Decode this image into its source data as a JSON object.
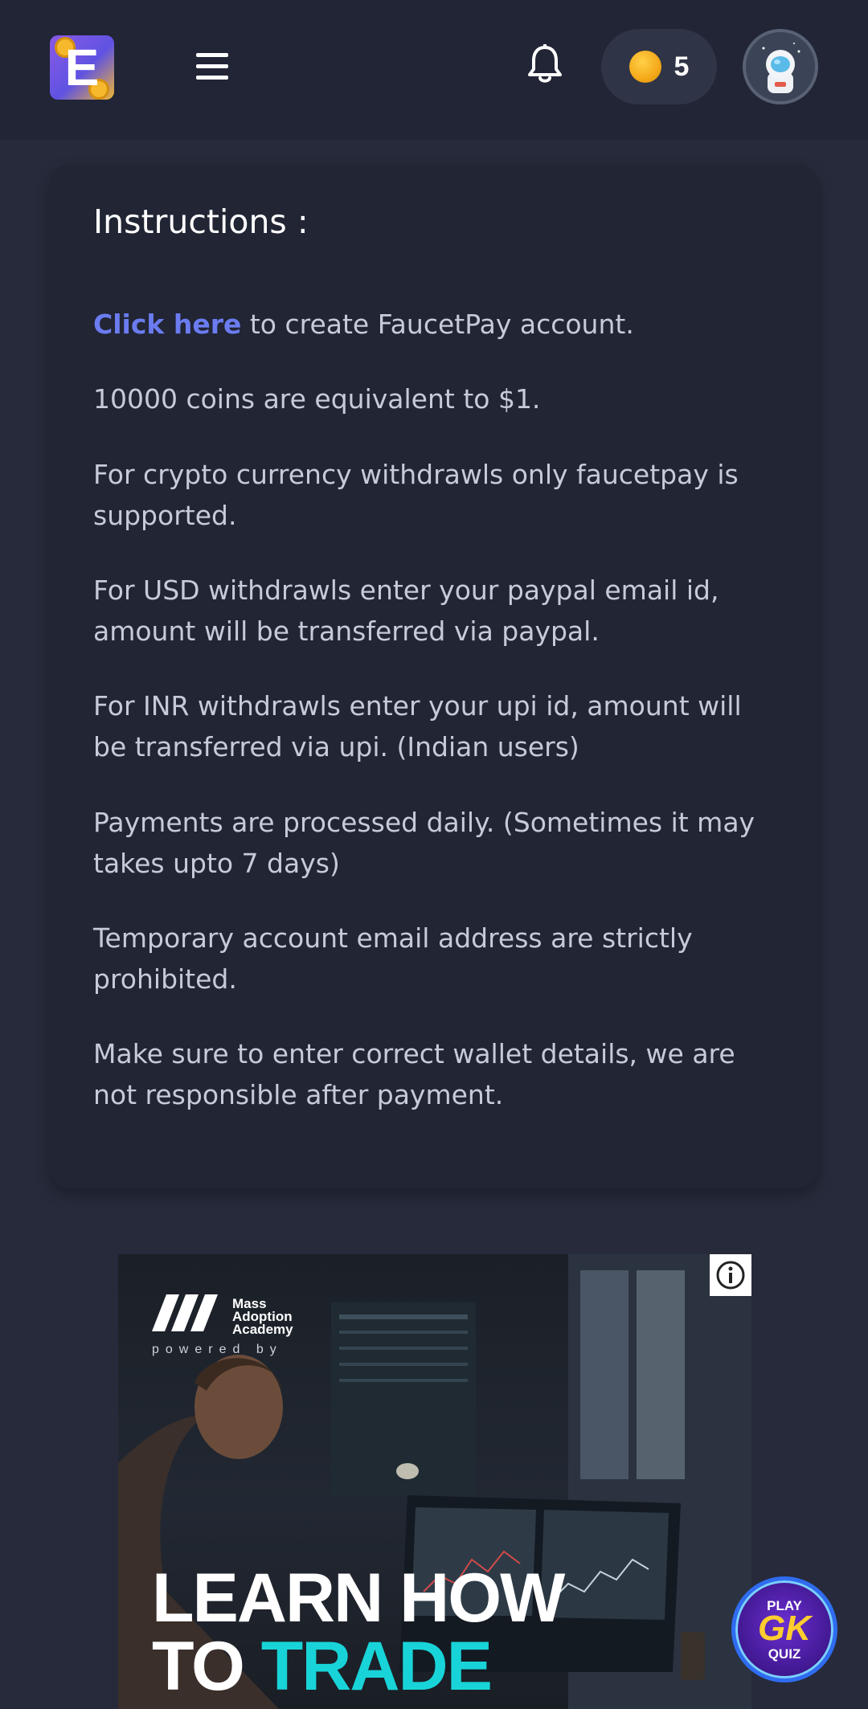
{
  "header": {
    "logo_letter": "E",
    "coin_count": "5",
    "icons": {
      "menu": "hamburger-menu-icon",
      "notifications": "bell-icon",
      "coin": "gold-coin-icon",
      "avatar": "astronaut-avatar"
    }
  },
  "instructions": {
    "title": "Instructions :",
    "link_text": "Click here",
    "link_suffix": " to create FaucetPay account.",
    "items": [
      "10000 coins are equivalent to $1.",
      "For crypto currency withdrawls only faucetpay is supported.",
      "For USD withdrawls enter your paypal email id, amount will be transferred via paypal.",
      "For INR withdrawls enter your upi id, amount will be transferred via upi. (Indian users)",
      "Payments are processed daily. (Sometimes it may takes upto 7 days)",
      "Temporary account email address are strictly prohibited.",
      "Make sure to enter correct wallet details, we are not responsible after payment."
    ]
  },
  "ad": {
    "brand_name": "Mass Adoption Academy",
    "powered_by": "powered by",
    "headline_line1": "LEARN HOW",
    "headline_line2_prefix": "TO ",
    "headline_line2_accent": "TRADE"
  },
  "quiz_button": {
    "play": "PLAY",
    "gk": "GK",
    "quiz": "QUIZ"
  },
  "colors": {
    "background": "#262a3a",
    "header": "#212536",
    "card": "#212534",
    "link": "#6b7cf0",
    "ad_accent": "#18d4d8",
    "coin": "#f4a91a"
  }
}
